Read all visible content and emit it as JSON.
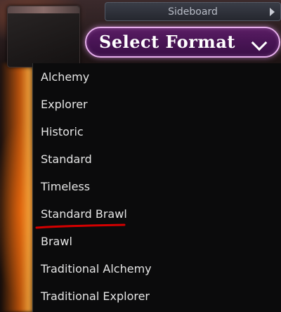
{
  "sideboard": {
    "label": "Sideboard"
  },
  "format_select": {
    "label": "Select Format"
  },
  "dropdown": {
    "options": [
      "Alchemy",
      "Explorer",
      "Historic",
      "Standard",
      "Timeless",
      "Standard Brawl",
      "Brawl",
      "Traditional Alchemy",
      "Traditional Explorer"
    ],
    "highlighted": "Standard Brawl"
  },
  "colors": {
    "select_border": "#e8b0ee",
    "select_fill": "#4a1556",
    "annotation_underline": "#d40000"
  }
}
